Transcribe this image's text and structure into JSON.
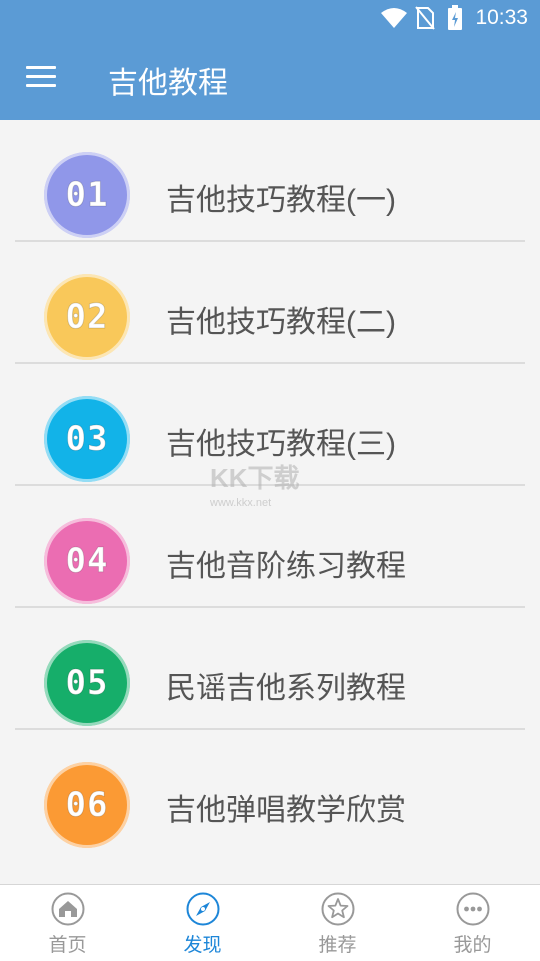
{
  "status_bar": {
    "time": "10:33",
    "icons": [
      "wifi-icon",
      "no-sim-icon",
      "battery-charging-icon"
    ]
  },
  "toolbar": {
    "title": "吉他教程",
    "menu_icon": "menu-icon"
  },
  "colors": {
    "appbar": "#5b9bd5",
    "active_tab": "#1d86d8",
    "inactive_tab": "#999999"
  },
  "list": [
    {
      "number": "01",
      "label": "吉他技巧教程(一)",
      "color": "#9097e9"
    },
    {
      "number": "02",
      "label": "吉他技巧教程(二)",
      "color": "#f9c85a"
    },
    {
      "number": "03",
      "label": "吉他技巧教程(三)",
      "color": "#12b3e8"
    },
    {
      "number": "04",
      "label": "吉他音阶练习教程",
      "color": "#eb6db2"
    },
    {
      "number": "05",
      "label": "民谣吉他系列教程",
      "color": "#16ae6a"
    },
    {
      "number": "06",
      "label": "吉他弹唱教学欣赏",
      "color": "#fb9a34"
    }
  ],
  "watermark": {
    "brand": "KK下载",
    "url": "www.kkx.net"
  },
  "bottom_nav": [
    {
      "label": "首页",
      "icon": "home-icon",
      "active": false
    },
    {
      "label": "发现",
      "icon": "compass-icon",
      "active": true
    },
    {
      "label": "推荐",
      "icon": "star-icon",
      "active": false
    },
    {
      "label": "我的",
      "icon": "more-icon",
      "active": false
    }
  ]
}
